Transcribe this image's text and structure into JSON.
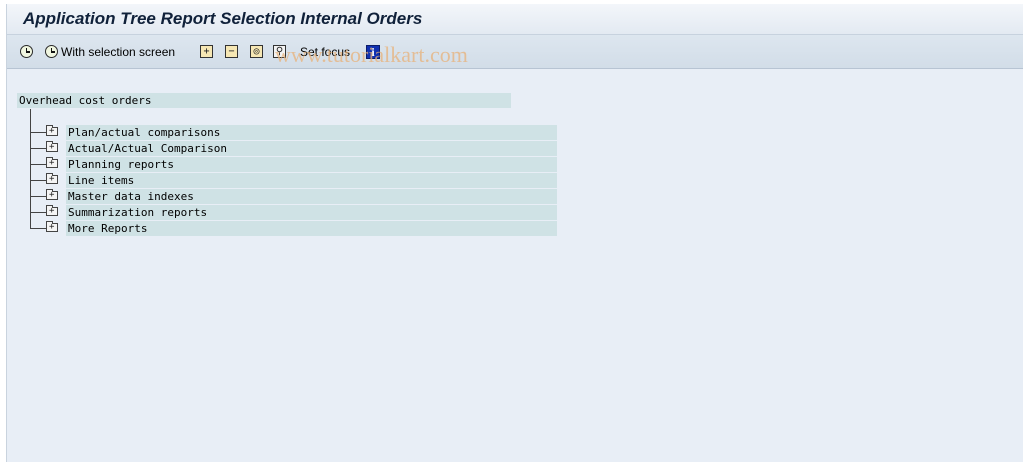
{
  "window": {
    "title": "Application Tree Report Selection Internal Orders"
  },
  "toolbar": {
    "execute_icon": "clock-execute-icon",
    "with_selection_label": "With selection screen",
    "expand_icon": "expand-subtree-icon",
    "collapse_icon": "collapse-subtree-icon",
    "find_icon": "find-icon",
    "find_next_icon": "find-next-icon",
    "set_focus_label": "Set focus",
    "info_icon": "info-icon"
  },
  "watermark": "www.tutorialkart.com",
  "tree": {
    "root_label": "Overhead cost orders",
    "nodes": [
      "Plan/actual comparisons",
      "Actual/Actual Comparison",
      "Planning reports",
      "Line items",
      "Master data indexes",
      "Summarization reports",
      "More Reports"
    ]
  },
  "colors": {
    "background": "#e8eef6",
    "row_highlight": "#cfe2e5",
    "toolbar": "#d6e0ea"
  }
}
